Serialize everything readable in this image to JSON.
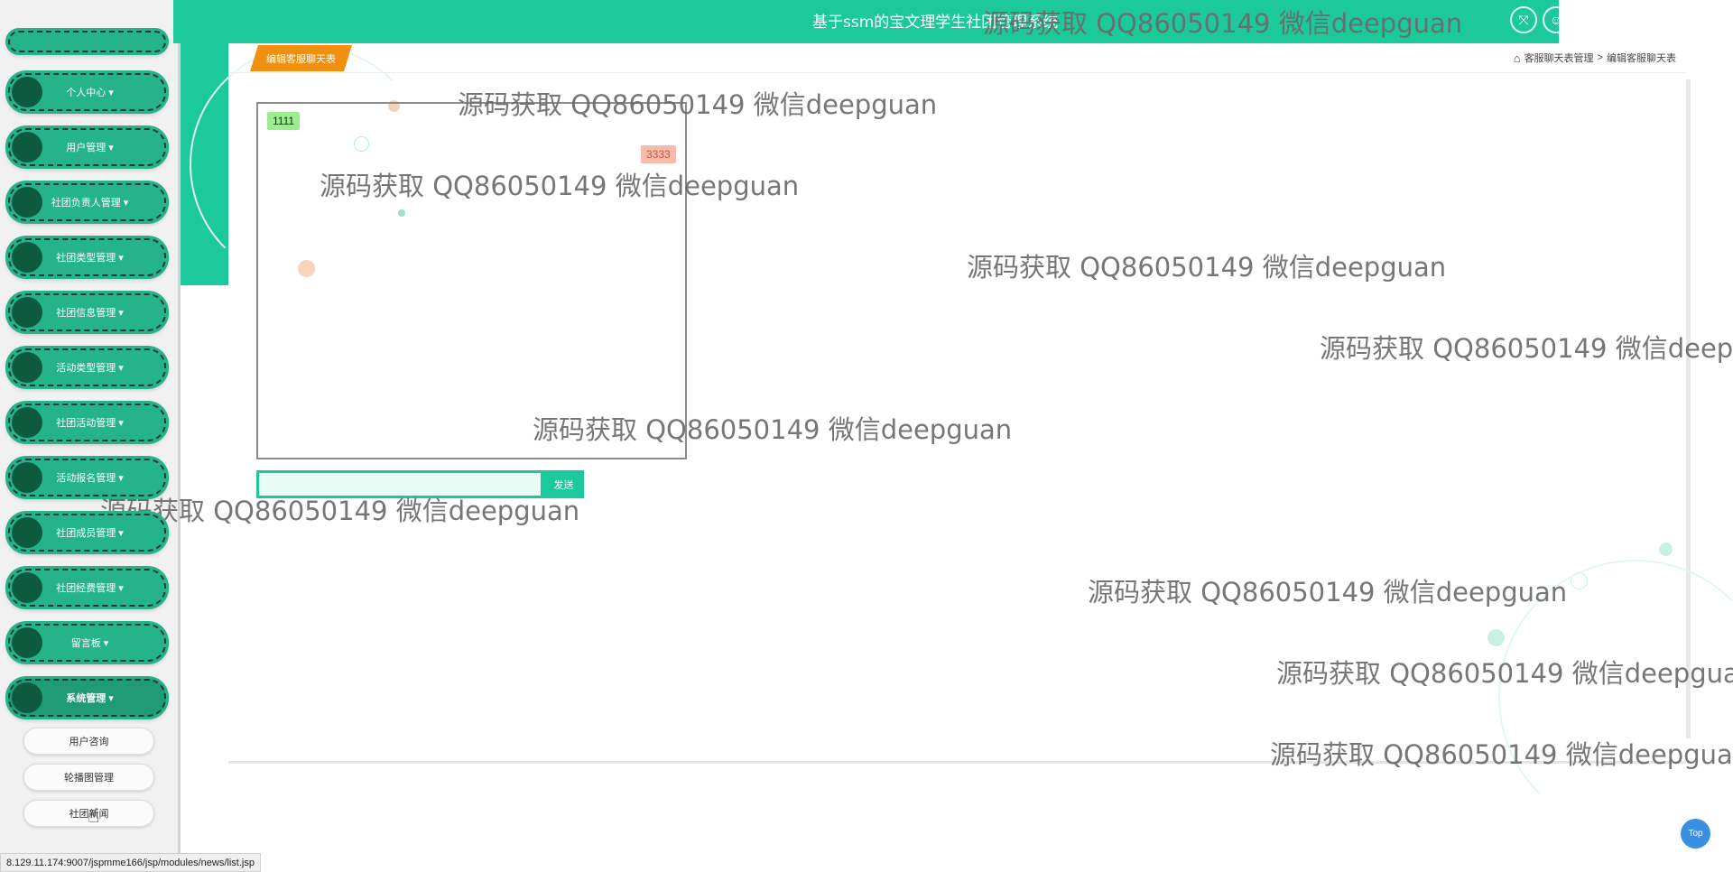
{
  "header": {
    "title": "基于ssm的宝文理学生社团管理系统"
  },
  "sidebar": {
    "items": [
      {
        "label": "个人中心 ▾"
      },
      {
        "label": "用户管理 ▾"
      },
      {
        "label": "社团负责人管理 ▾"
      },
      {
        "label": "社团类型管理 ▾"
      },
      {
        "label": "社团信息管理 ▾"
      },
      {
        "label": "活动类型管理 ▾"
      },
      {
        "label": "社团活动管理 ▾"
      },
      {
        "label": "活动报名管理 ▾"
      },
      {
        "label": "社团成员管理 ▾"
      },
      {
        "label": "社团经费管理 ▾"
      },
      {
        "label": "留言板 ▾"
      },
      {
        "label": "系统管理 ▾"
      }
    ],
    "sub_items": [
      {
        "label": "用户咨询"
      },
      {
        "label": "轮播图管理"
      },
      {
        "label": "社团新闻"
      }
    ]
  },
  "page": {
    "tag": "编辑客服聊天表",
    "breadcrumb": [
      "客服聊天表管理",
      ">",
      "编辑客服聊天表"
    ]
  },
  "chat": {
    "messages": [
      {
        "side": "left",
        "text": "1111"
      },
      {
        "side": "right",
        "text": "3333"
      }
    ],
    "input_value": "",
    "send_label": "发送"
  },
  "watermark_text": "源码获取 QQ86050149 微信deepguan",
  "status_url": "8.129.11.174:9007/jspmme166/jsp/modules/news/list.jsp",
  "top_button": "Top",
  "colors": {
    "primary": "#1cc99b",
    "sidebar_button": "#25b38a",
    "page_tag": "#f0900e",
    "msg_left_bg": "#9aee8d",
    "msg_right_bg": "#f7bca9"
  }
}
